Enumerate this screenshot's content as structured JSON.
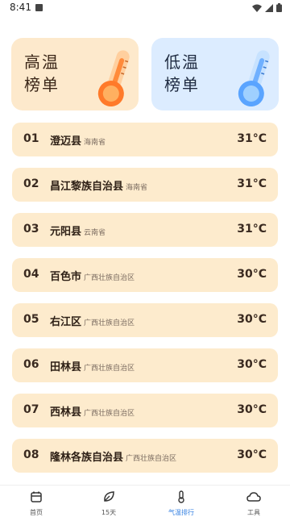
{
  "status": {
    "time": "8:41"
  },
  "hero": {
    "high": {
      "line1": "高温",
      "line2": "榜单"
    },
    "low": {
      "line1": "低温",
      "line2": "榜单"
    }
  },
  "list": [
    {
      "rank": "01",
      "name": "澄迈县",
      "province": "海南省",
      "temp": "31°C"
    },
    {
      "rank": "02",
      "name": "昌江黎族自治县",
      "province": "海南省",
      "temp": "31°C"
    },
    {
      "rank": "03",
      "name": "元阳县",
      "province": "云南省",
      "temp": "31°C"
    },
    {
      "rank": "04",
      "name": "百色市",
      "province": "广西壮族自治区",
      "temp": "30°C"
    },
    {
      "rank": "05",
      "name": "右江区",
      "province": "广西壮族自治区",
      "temp": "30°C"
    },
    {
      "rank": "06",
      "name": "田林县",
      "province": "广西壮族自治区",
      "temp": "30°C"
    },
    {
      "rank": "07",
      "name": "西林县",
      "province": "广西壮族自治区",
      "temp": "30°C"
    },
    {
      "rank": "08",
      "name": "隆林各族自治县",
      "province": "广西壮族自治区",
      "temp": "30°C"
    }
  ],
  "tabs": [
    {
      "label": "首页",
      "icon": "calendar-icon"
    },
    {
      "label": "15天",
      "icon": "leaf-icon"
    },
    {
      "label": "气温排行",
      "icon": "thermometer-icon",
      "active": true
    },
    {
      "label": "工具",
      "icon": "cloud-icon"
    }
  ],
  "colors": {
    "accent": "#2f7de1",
    "high_card": "#fde9cc",
    "low_card": "#dcecff",
    "row_bg": "#fdebcd"
  }
}
